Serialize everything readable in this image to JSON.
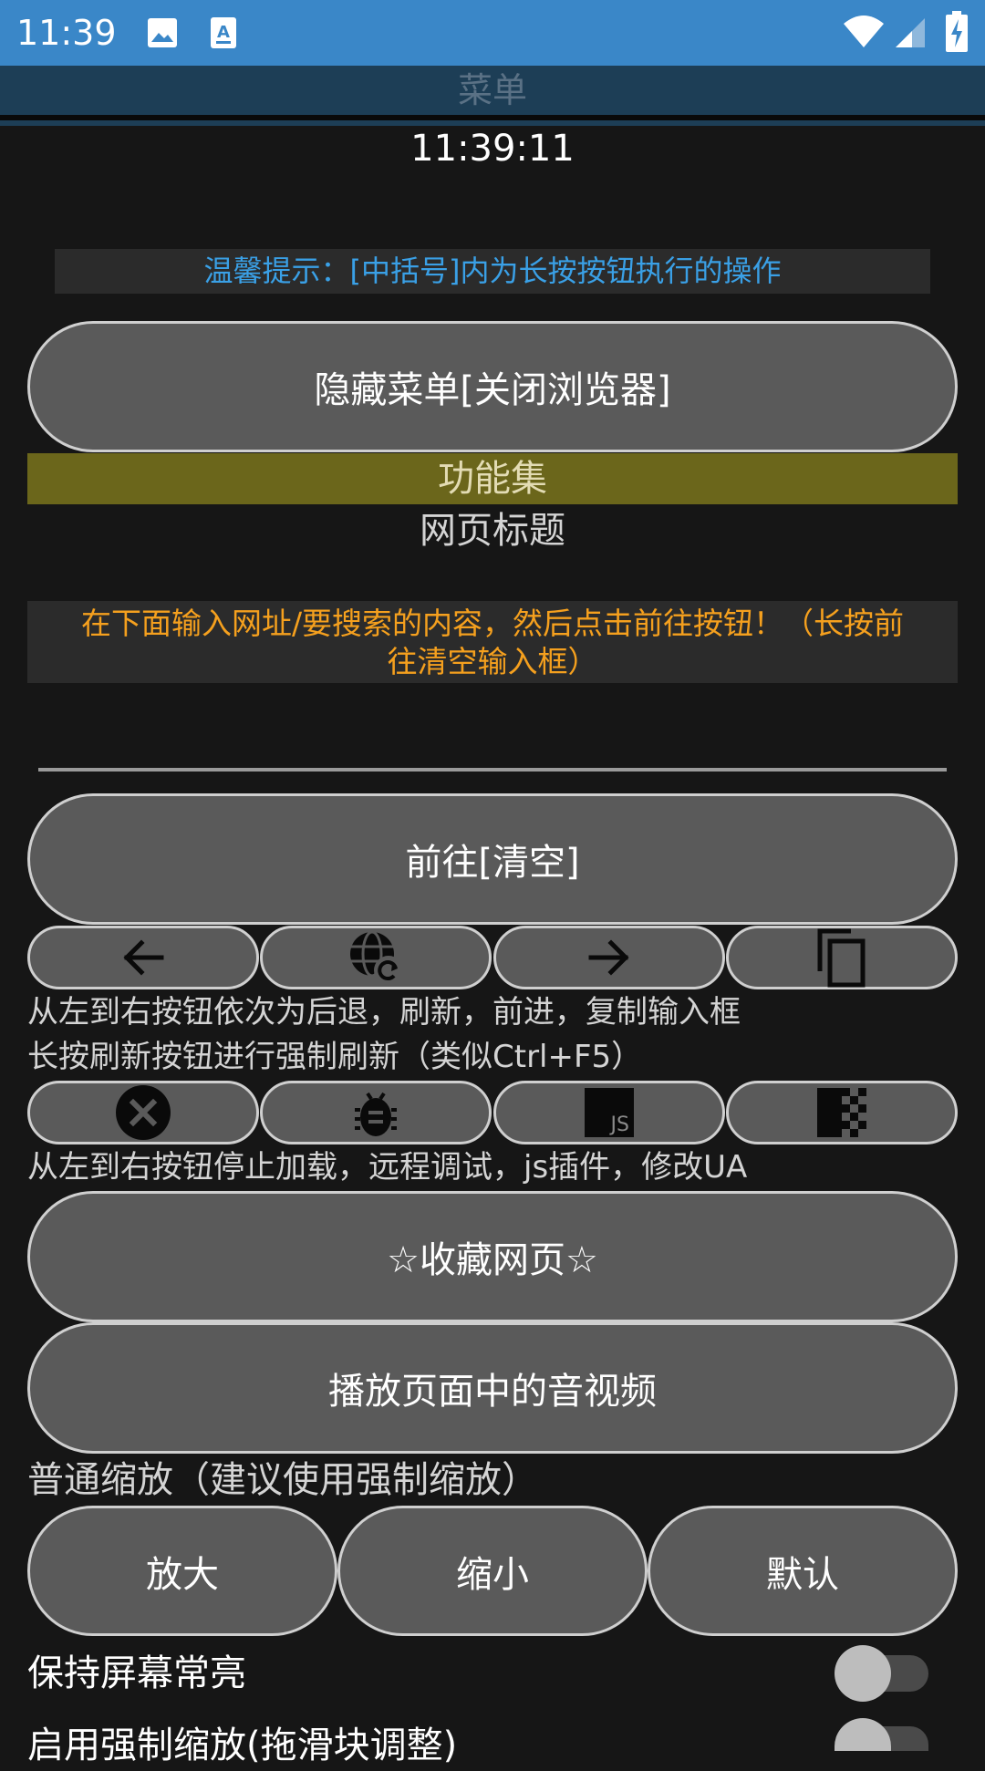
{
  "status_bar": {
    "time": "11:39",
    "icons": [
      "image-icon",
      "text-icon",
      "wifi-icon",
      "signal-icon",
      "battery-charging-icon"
    ]
  },
  "header": {
    "title": "菜单"
  },
  "clock": "11:39:11",
  "tip": "温馨提示：[中括号]内为长按按钮执行的操作",
  "buttons": {
    "hide_menu": "隐藏菜单[关闭浏览器]",
    "go": "前往[清空]",
    "favorite": "☆收藏网页☆",
    "play_media": "播放页面中的音视频"
  },
  "feature_set": "功能集",
  "page_title": "网页标题",
  "url_hint": {
    "line1": "在下面输入网址/要搜索的内容，然后点击前往按钮！（长按前",
    "line2": "往清空输入框）"
  },
  "url_input": {
    "value": ""
  },
  "nav_row_icons": [
    "arrow-left-icon",
    "globe-refresh-icon",
    "arrow-right-icon",
    "copy-icon"
  ],
  "captions": {
    "nav_desc": "从左到右按钮依次为后退，刷新，前进，复制输入框",
    "refresh_desc": "长按刷新按钮进行强制刷新（类似Ctrl+F5）",
    "tools_desc": "从左到右按钮停止加载，远程调试，js插件，修改UA",
    "zoom_title": "普通缩放（建议使用强制缩放）"
  },
  "tools_row_icons": [
    "stop-icon",
    "bug-icon",
    "js-icon",
    "user-agent-icon"
  ],
  "js_icon_text": "JS",
  "zoom": {
    "in": "放大",
    "out": "缩小",
    "default": "默认"
  },
  "settings": [
    {
      "label": "保持屏幕常亮",
      "enabled": false
    },
    {
      "label": "启用强制缩放(拖滑块调整)",
      "enabled": false
    }
  ],
  "colors": {
    "status_bar": "#3a87c8",
    "title_bar": "#1d3e56",
    "background": "#161616",
    "button": "#5a5a5a",
    "tip_text": "#3aa0e6",
    "hint_text": "#f5a01e",
    "feature_bar": "#6b661b"
  }
}
